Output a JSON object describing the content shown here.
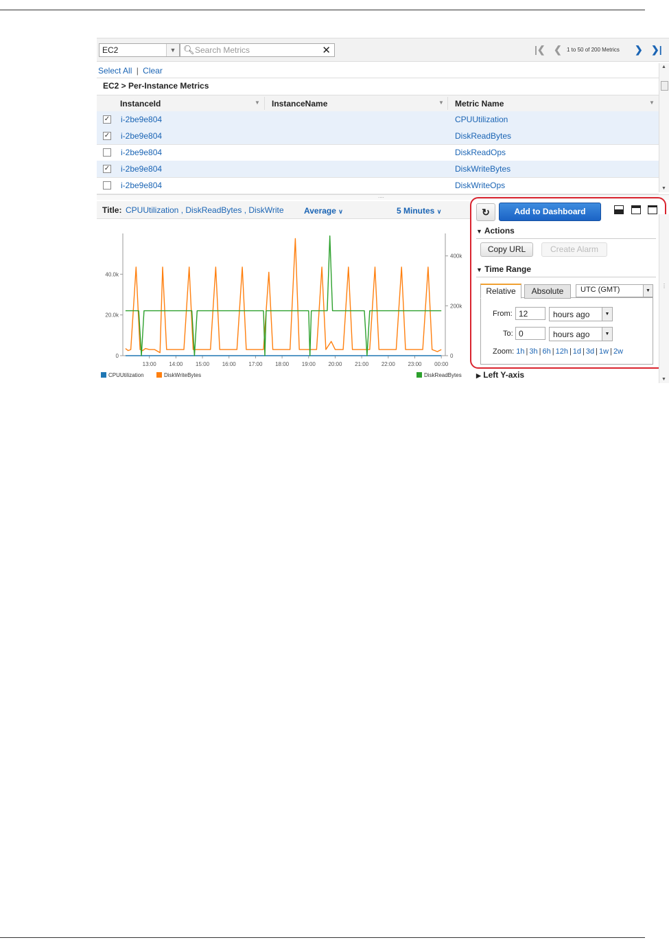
{
  "toolbar": {
    "namespace": "EC2",
    "search_placeholder": "Search Metrics",
    "pager_text": "1 to 50 of 200 Metrics"
  },
  "selection": {
    "select_all": "Select All",
    "divider": "|",
    "clear": "Clear"
  },
  "breadcrumb": "EC2 > Per-Instance Metrics",
  "table": {
    "columns": [
      "InstanceId",
      "InstanceName",
      "Metric Name"
    ],
    "rows": [
      {
        "checked": true,
        "instance_id": "i-2be9e804",
        "instance_name": "",
        "metric": "CPUUtilization"
      },
      {
        "checked": true,
        "instance_id": "i-2be9e804",
        "instance_name": "",
        "metric": "DiskReadBytes"
      },
      {
        "checked": false,
        "instance_id": "i-2be9e804",
        "instance_name": "",
        "metric": "DiskReadOps"
      },
      {
        "checked": true,
        "instance_id": "i-2be9e804",
        "instance_name": "",
        "metric": "DiskWriteBytes"
      },
      {
        "checked": false,
        "instance_id": "i-2be9e804",
        "instance_name": "",
        "metric": "DiskWriteOps"
      }
    ]
  },
  "graph": {
    "title_label": "Title:",
    "title_value": "CPUUtilization , DiskReadBytes , DiskWrite",
    "statistic": "Average",
    "period": "5 Minutes"
  },
  "chart_data": {
    "type": "line",
    "x_ticks": [
      "13:00",
      "14:00",
      "15:00",
      "16:00",
      "17:00",
      "18:00",
      "19:00",
      "20:00",
      "21:00",
      "22:00",
      "23:00",
      "00:00"
    ],
    "left_y_ticks": [
      "0",
      "20.0k",
      "40.0k"
    ],
    "right_y_ticks": [
      "0",
      "200k",
      "400k"
    ],
    "left_ylim": [
      0,
      60000
    ],
    "right_ylim": [
      0,
      490000
    ],
    "grid": false,
    "legend": "bottom",
    "series": [
      {
        "name": "CPUUtilization",
        "axis": "left",
        "color": "#1f77b4",
        "points": [
          [
            12.1,
            0
          ],
          [
            24.0,
            0
          ]
        ]
      },
      {
        "name": "DiskWriteBytes",
        "axis": "left",
        "color": "#ff7f0e",
        "points": [
          [
            12.1,
            3500
          ],
          [
            12.2,
            2500
          ],
          [
            12.3,
            3000
          ],
          [
            12.5,
            43500
          ],
          [
            12.65,
            3000
          ],
          [
            12.75,
            2500
          ],
          [
            12.85,
            3500
          ],
          [
            13.0,
            3000
          ],
          [
            13.2,
            3000
          ],
          [
            13.4,
            1500
          ],
          [
            13.5,
            43500
          ],
          [
            13.65,
            3000
          ],
          [
            14.0,
            3000
          ],
          [
            14.3,
            3000
          ],
          [
            14.5,
            43500
          ],
          [
            14.65,
            3000
          ],
          [
            15.0,
            3000
          ],
          [
            15.3,
            3000
          ],
          [
            15.5,
            43500
          ],
          [
            15.65,
            3000
          ],
          [
            16.0,
            3000
          ],
          [
            16.3,
            3000
          ],
          [
            16.5,
            43500
          ],
          [
            16.65,
            3000
          ],
          [
            17.0,
            3000
          ],
          [
            17.3,
            3000
          ],
          [
            17.5,
            41000
          ],
          [
            17.65,
            3000
          ],
          [
            18.0,
            3000
          ],
          [
            18.3,
            3000
          ],
          [
            18.5,
            57500
          ],
          [
            18.65,
            3000
          ],
          [
            19.0,
            3000
          ],
          [
            19.3,
            3000
          ],
          [
            19.5,
            43500
          ],
          [
            19.65,
            3000
          ],
          [
            19.85,
            7000
          ],
          [
            20.0,
            3000
          ],
          [
            20.3,
            3000
          ],
          [
            20.5,
            43500
          ],
          [
            20.65,
            3000
          ],
          [
            21.0,
            3000
          ],
          [
            21.3,
            3000
          ],
          [
            21.5,
            43500
          ],
          [
            21.65,
            3000
          ],
          [
            22.0,
            3000
          ],
          [
            22.3,
            3000
          ],
          [
            22.5,
            43500
          ],
          [
            22.65,
            3000
          ],
          [
            23.0,
            3000
          ],
          [
            23.3,
            3000
          ],
          [
            23.5,
            43500
          ],
          [
            23.65,
            3000
          ],
          [
            23.85,
            2000
          ],
          [
            24.0,
            3000
          ]
        ]
      },
      {
        "name": "DiskReadBytes",
        "axis": "right",
        "color": "#2ca02c",
        "points": [
          [
            12.1,
            180000
          ],
          [
            12.6,
            180000
          ],
          [
            12.7,
            0
          ],
          [
            12.8,
            180000
          ],
          [
            14.6,
            180000
          ],
          [
            14.7,
            0
          ],
          [
            14.8,
            180000
          ],
          [
            17.3,
            180000
          ],
          [
            17.35,
            0
          ],
          [
            17.4,
            180000
          ],
          [
            18.8,
            180000
          ],
          [
            19.0,
            180000
          ],
          [
            19.05,
            0
          ],
          [
            19.1,
            180000
          ],
          [
            19.7,
            180000
          ],
          [
            19.8,
            480000
          ],
          [
            19.9,
            180000
          ],
          [
            21.1,
            180000
          ],
          [
            21.2,
            0
          ],
          [
            21.3,
            180000
          ],
          [
            24.0,
            180000
          ]
        ]
      }
    ]
  },
  "panel": {
    "refresh_icon": "↻",
    "add_to_dashboard": "Add to Dashboard",
    "actions_heading": "Actions",
    "copy_url": "Copy URL",
    "create_alarm": "Create Alarm",
    "time_range_heading": "Time Range",
    "tab_relative": "Relative",
    "tab_absolute": "Absolute",
    "timezone": "UTC (GMT)",
    "from_label": "From:",
    "from_value": "12",
    "from_unit": "hours ago",
    "to_label": "To:",
    "to_value": "0",
    "to_unit": "hours ago",
    "zoom_label": "Zoom:",
    "zoom_options": [
      "1h",
      "3h",
      "6h",
      "12h",
      "1d",
      "3d",
      "1w",
      "2w"
    ],
    "left_y_axis": "Left Y-axis"
  },
  "colors": {
    "link": "#1a64b4",
    "highlight_border": "#d9232e",
    "primary_button": "#1b63c5"
  }
}
